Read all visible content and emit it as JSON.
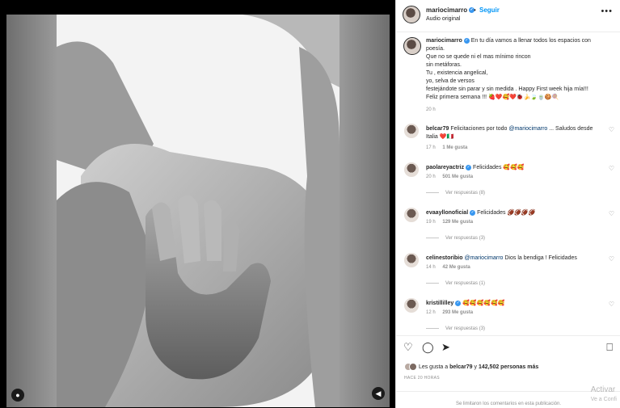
{
  "post": {
    "username": "mariocimarro",
    "follow_label": "Seguir",
    "dot": "•",
    "audio": "Audio original",
    "more": "•••"
  },
  "caption": {
    "username": "mariocimarro",
    "lines": [
      "En tu día vamos a llenar todos los espacios con poesía.",
      "Que no se quede ni el mas mínimo rincon",
      "sin metáforas.",
      "Tu , existencia angelical,",
      "yo, selva de versos",
      "festejándote sin parar y sin medida . Happy First week hija mía!!!",
      "Feliz primera semana !!! 🍓❤️🥰❤️🐞🍌🍃🍵🍪🍭"
    ],
    "time": "20 h"
  },
  "comments": [
    {
      "username": "belcar79",
      "text": "Felicitaciones por todo",
      "mention": "@mariocimarro",
      "text2": "... Saludos desde Italia ❤️🇮🇹",
      "time": "17 h",
      "likes": "1 Me gusta",
      "replies": ""
    },
    {
      "username": "paolareyactriz",
      "text": "Felicidades 🥰🥰🥰",
      "mention": "",
      "text2": "",
      "time": "20 h",
      "likes": "501 Me gusta",
      "replies": "Ver respuestas (8)"
    },
    {
      "username": "evaayllonoficial",
      "text": "Felicidades 🏈🏈🏈🏈",
      "mention": "",
      "text2": "",
      "time": "19 h",
      "likes": "129 Me gusta",
      "replies": "Ver respuestas (3)"
    },
    {
      "username": "celinestoribio",
      "text": "",
      "mention": "@mariocimarro",
      "text2": "Dios la bendiga ! Felicidades",
      "time": "14 h",
      "likes": "42 Me gusta",
      "replies": "Ver respuestas (1)"
    },
    {
      "username": "kristillilley",
      "text": "🥰🥰🥰🥰🥰🥰",
      "mention": "",
      "text2": "",
      "time": "12 h",
      "likes": "293 Me gusta",
      "replies": "Ver respuestas (3)"
    }
  ],
  "footer": {
    "likes_prefix": "Les gusta a",
    "likes_user": "belcar79",
    "likes_middle": "y",
    "likes_count": "142,502 personas más",
    "date": "HACE 20 HORAS",
    "disabled": "Se limitaron los comentarios en esta publicación."
  },
  "watermark": {
    "line1": "Activar",
    "line2": "Ve a Confi"
  },
  "icons": {
    "heart": "heart-icon",
    "comment": "comment-icon",
    "share": "share-icon",
    "save": "bookmark-icon",
    "user_tag": "user-tag-icon",
    "mute": "mute-icon"
  }
}
